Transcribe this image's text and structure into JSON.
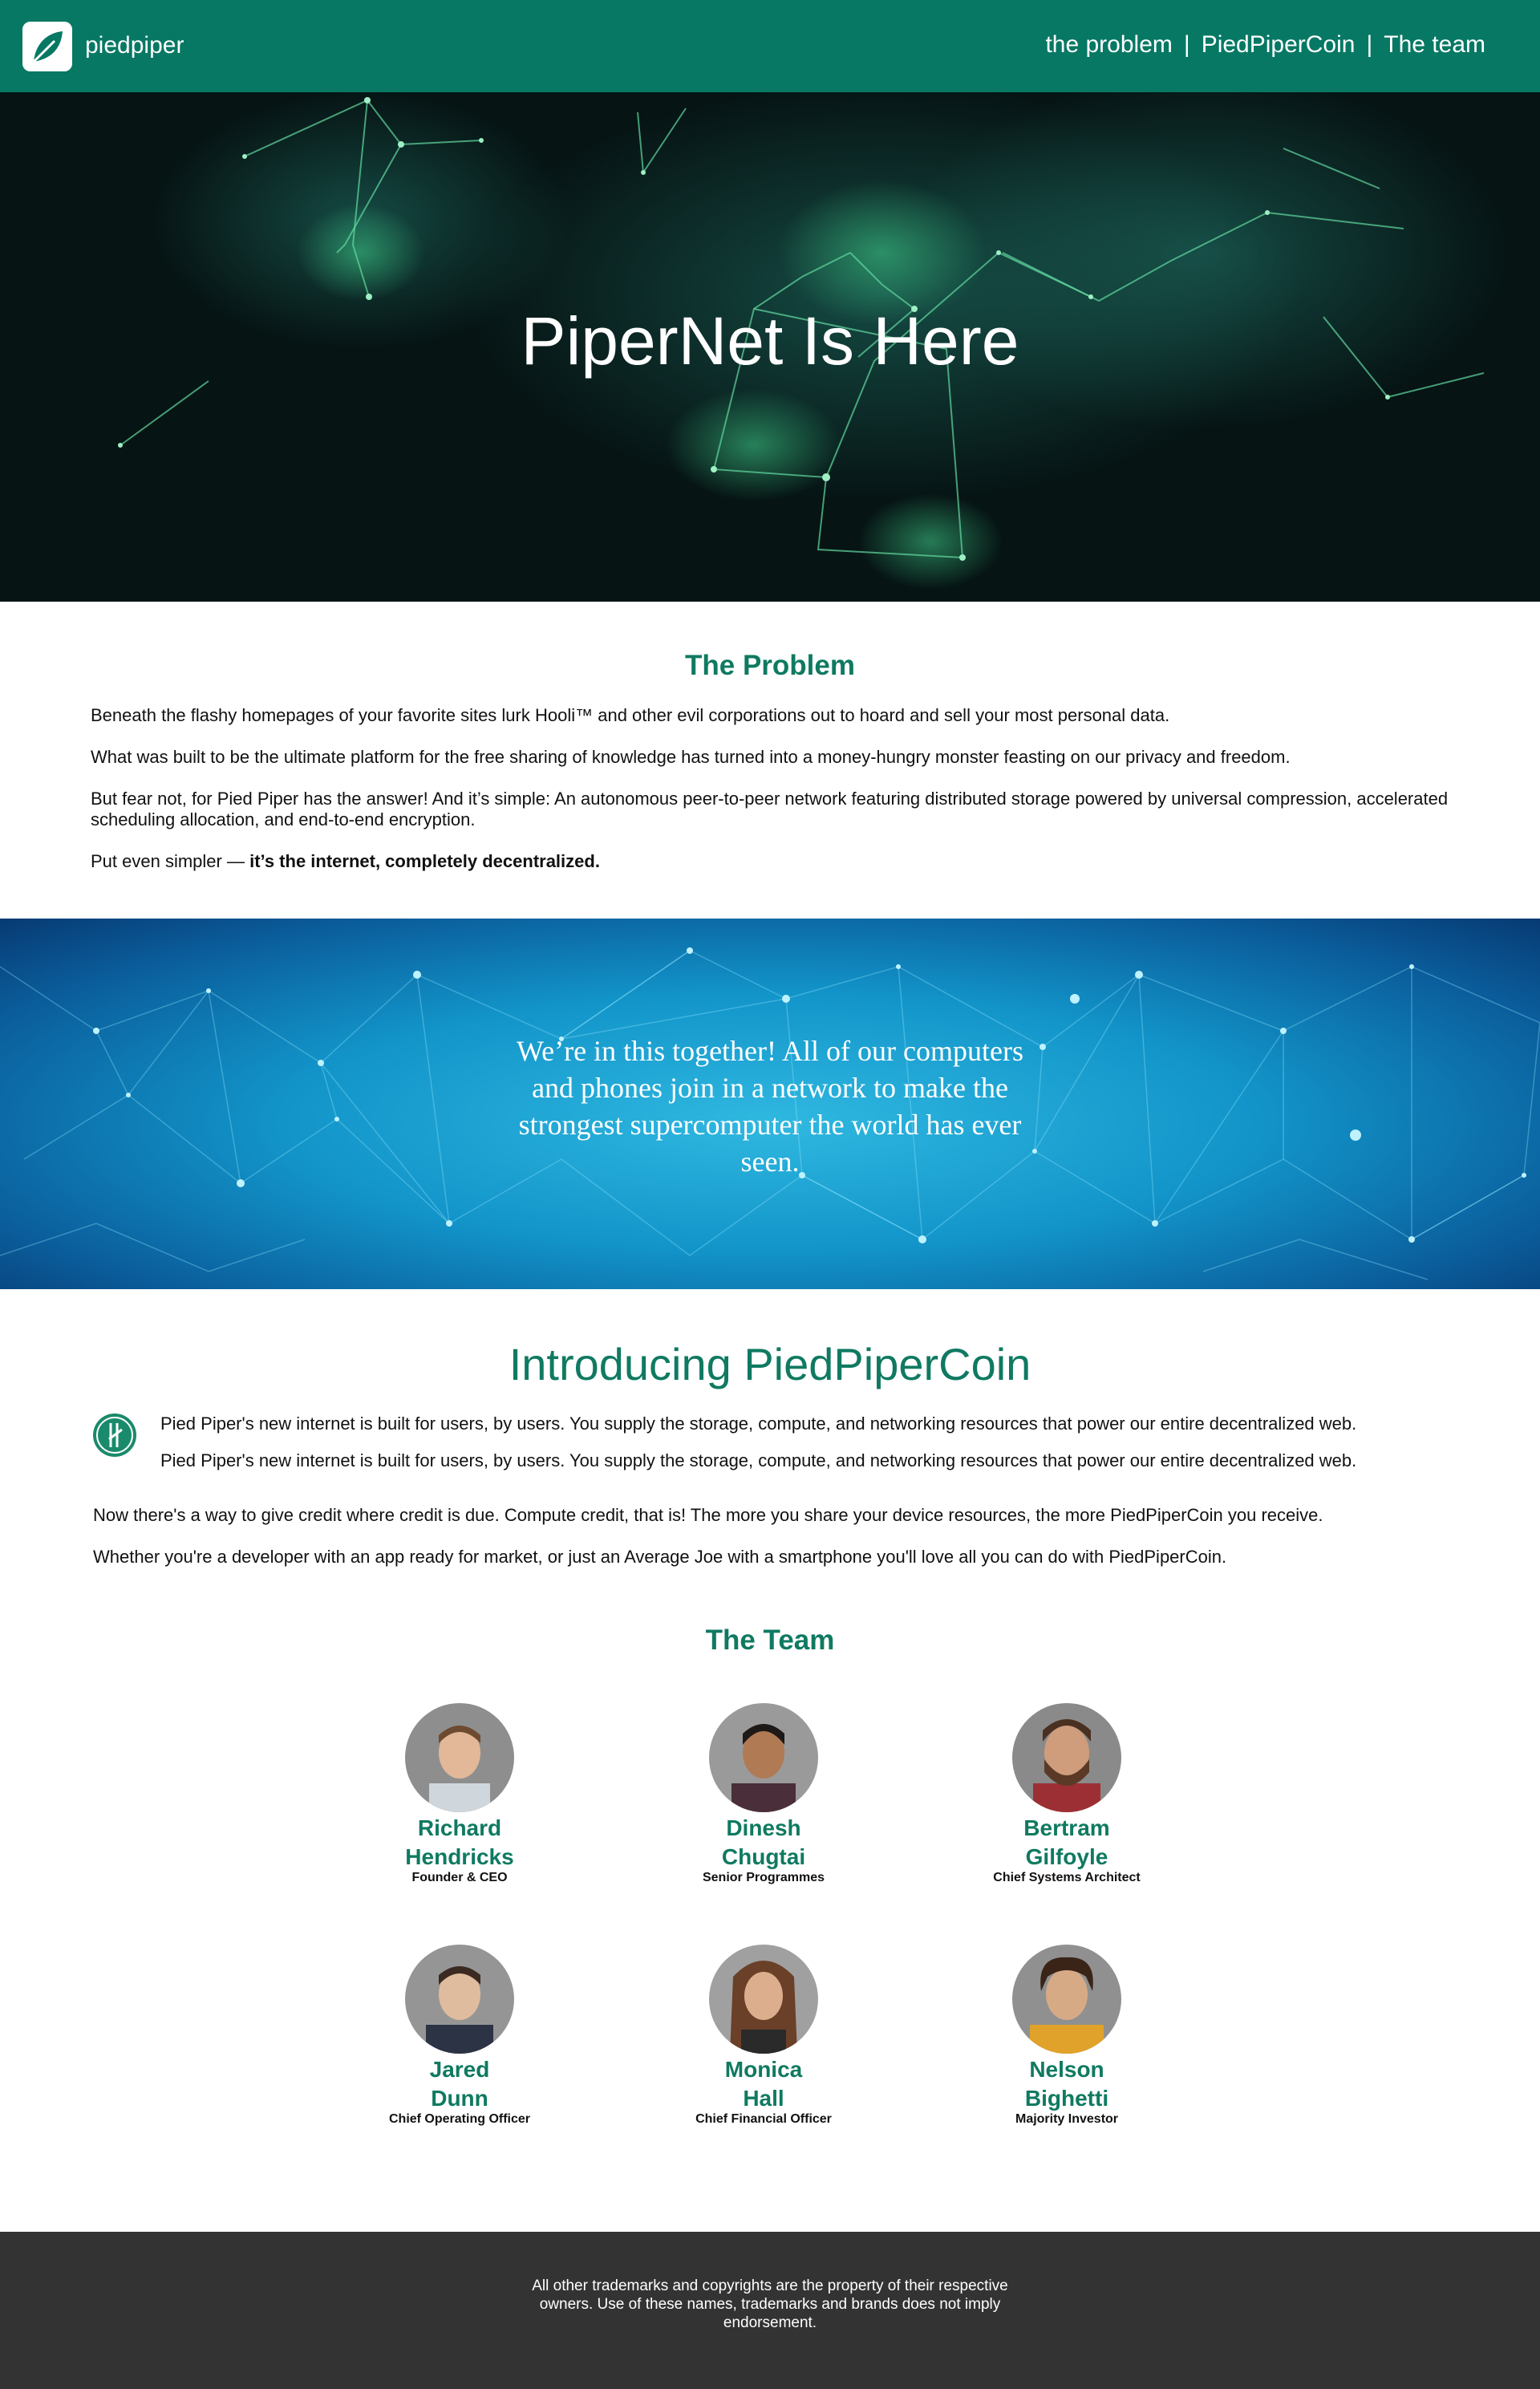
{
  "nav": {
    "brand": "piedpiper",
    "links": [
      "the problem",
      "PiedPiperCoin",
      "The team"
    ],
    "separator": "|",
    "background": "#077864"
  },
  "hero": {
    "title": "PiperNet Is Here"
  },
  "problem": {
    "heading": "The Problem",
    "paragraphs": [
      "Beneath the flashy homepages of your favorite sites lurk Hooli™ and other evil corporations out to hoard and sell your most personal data.",
      "What was built to be the ultimate platform for the free sharing of knowledge has turned into a money-hungry monster feasting on our privacy and freedom.",
      "But fear not, for Pied Piper has the answer! And it’s simple: An autonomous peer-to-peer network featuring distributed storage powered by universal compression, accelerated scheduling allocation, and end-to-end encryption."
    ],
    "simpler_prefix": "Put even simpler —",
    "simpler_bold": "it’s the internet, completely decentralized."
  },
  "band": {
    "quote": "We’re in this together! All of our computers and phones join in a network to make the strongest supercomputer the world has ever seen."
  },
  "coin": {
    "heading": "Introducing PiedPiperCoin",
    "icon": "piedpipercoin-icon",
    "lines": [
      "Pied Piper's new internet is built for users, by users. You supply the storage, compute, and networking resources that power our entire decentralized web.",
      "Pied Piper's new internet is built for users, by users. You supply the storage, compute, and networking resources that power our entire decentralized web."
    ],
    "paragraphs": [
      "Now there's a way to give credit where credit is due. Compute credit, that is! The more you share your device resources, the more PiedPiperCoin you receive.",
      "Whether you're a developer with an app ready for market, or just an Average Joe with a smartphone you'll love all you can do with PiedPiperCoin."
    ]
  },
  "team": {
    "heading": "The Team",
    "members": [
      {
        "first": "Richard",
        "last": "Hendricks",
        "role": "Founder & CEO"
      },
      {
        "first": "Dinesh",
        "last": "Chugtai",
        "role": "Senior Programmes"
      },
      {
        "first": "Bertram",
        "last": "Gilfoyle",
        "role": "Chief Systems Architect"
      },
      {
        "first": "Jared",
        "last": "Dunn",
        "role": "Chief Operating Officer"
      },
      {
        "first": "Monica",
        "last": "Hall",
        "role": "Chief Financial Officer"
      },
      {
        "first": "Nelson",
        "last": "Bighetti",
        "role": "Majority Investor"
      }
    ]
  },
  "footer": {
    "text": "All other trademarks and copyrights are the property of their respective owners. Use of these names, trademarks and brands does not imply endorsement."
  },
  "colors": {
    "brand_green": "#0f7a61",
    "footer_bg": "#333333"
  }
}
